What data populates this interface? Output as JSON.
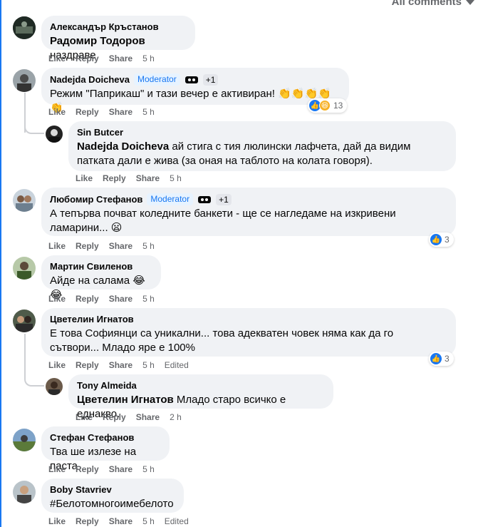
{
  "header": {
    "all_comments_label": "All comments"
  },
  "actions": {
    "like": "Like",
    "reply": "Reply",
    "share": "Share",
    "edited": "Edited"
  },
  "badges": {
    "moderator": "Moderator",
    "plus_one": "+1"
  },
  "comments": [
    {
      "author": "Александър Кръстанов",
      "tag": "Радомир Тодоров",
      "text": " наздраве",
      "time": "5 h"
    },
    {
      "author": "Nadejda Doicheva",
      "text": "Режим \"Паприкаш\" и тази вечер е активиран! 👏👏👏👏👏",
      "time": "5 h",
      "reactions_count": "13"
    },
    {
      "author": "Sin Butcer",
      "tag": "Nadejda Doicheva",
      "text": " ай стига с тия люлински лафчета, дай да видим патката дали е жива (за оная на таблото на колата говоря).",
      "time": "5 h"
    },
    {
      "author": "Любомир Стефанов",
      "text": "А тепърва почват коледните банкети - ще се нагледаме на изкривени ламарини... 😦",
      "time": "5 h",
      "reactions_count": "3"
    },
    {
      "author": "Мартин Свиленов",
      "text": "Айде на салама 😂😂",
      "time": "5 h"
    },
    {
      "author": "Цветелин Игнатов",
      "text": "Е това Софиянци са уникални... това адекватен човек няма как да го сътвори... Младо яре е 100%",
      "time": "5 h",
      "reactions_count": "3"
    },
    {
      "author": "Tony Almeida",
      "tag": "Цветелин Игнатов",
      "text": " Младо старо всичко е еднакво.",
      "time": "2 h"
    },
    {
      "author": "Стефан Стефанов",
      "text": "Тва ше излезе на паста",
      "time": "5 h"
    },
    {
      "author": "Boby Stavriev",
      "text": "#Белотомногоимебелото",
      "time": "5 h"
    }
  ],
  "colors": {
    "accent": "#1877f2",
    "bubble": "#f0f2f5",
    "muted": "#65676b"
  }
}
